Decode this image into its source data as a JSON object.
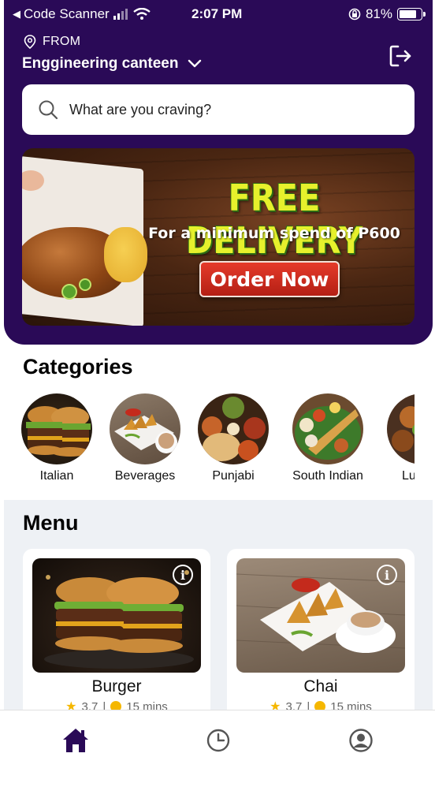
{
  "status_bar": {
    "back_app": "Code Scanner",
    "time": "2:07 PM",
    "battery": "81%",
    "battery_level": 0.81
  },
  "location": {
    "from_label": "FROM",
    "name": "Enggineering canteen"
  },
  "search": {
    "placeholder": "What are you craving?"
  },
  "banner": {
    "headline": "FREE DELIVERY",
    "subline": "For a minimum spend of P600",
    "cta": "Order Now"
  },
  "categories": {
    "title": "Categories",
    "items": [
      {
        "label": "Italian"
      },
      {
        "label": "Beverages"
      },
      {
        "label": "Punjabi"
      },
      {
        "label": "South Indian"
      },
      {
        "label": "Lu"
      }
    ]
  },
  "menu": {
    "title": "Menu",
    "items": [
      {
        "name": "Burger",
        "rating": "3.7",
        "time": "15 mins"
      },
      {
        "name": "Chai",
        "rating": "3.7",
        "time": "15 mins"
      }
    ]
  },
  "tabs": [
    {
      "icon": "home-icon",
      "active": true
    },
    {
      "icon": "clock-icon",
      "active": false
    },
    {
      "icon": "profile-icon",
      "active": false
    }
  ],
  "colors": {
    "brand": "#2a0a57",
    "banner_headline": "#e6f12c",
    "cta": "#d12d1f",
    "menu_bg": "#eef1f5"
  }
}
